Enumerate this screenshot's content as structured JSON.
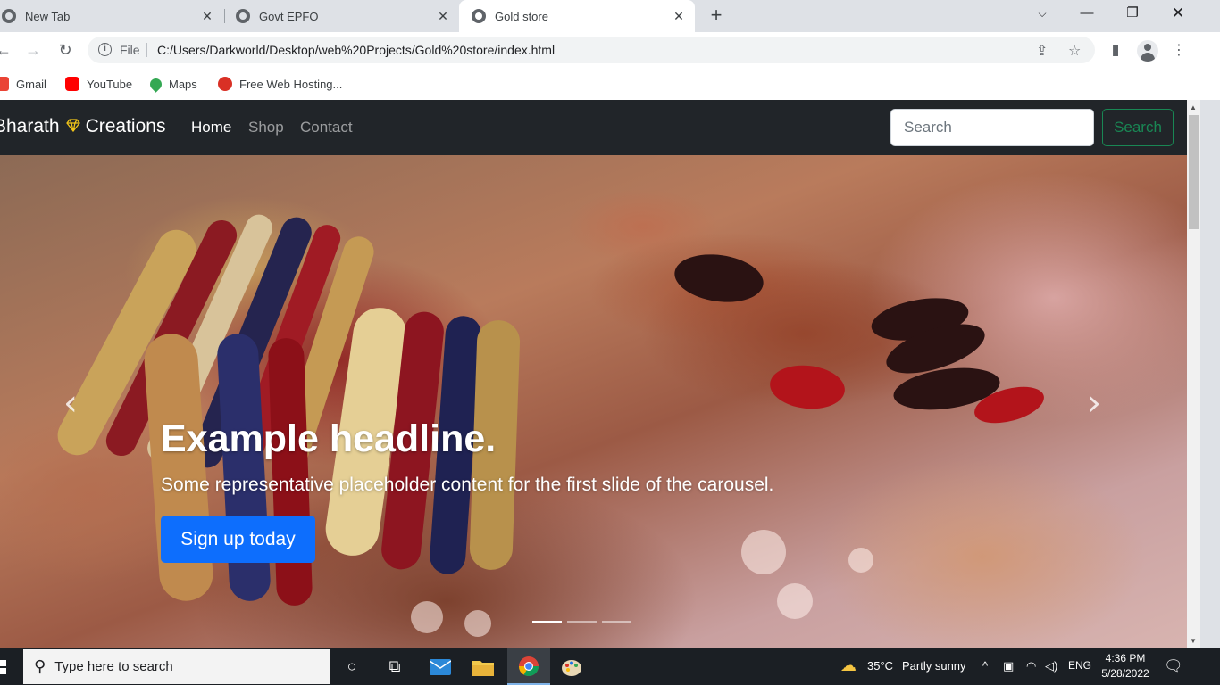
{
  "browser": {
    "tabs": [
      {
        "title": "New Tab",
        "active": false,
        "icon": "chrome-icon"
      },
      {
        "title": "Govt EPFO",
        "active": false,
        "icon": "globe-icon"
      },
      {
        "title": "Gold store",
        "active": true,
        "icon": "globe-icon"
      }
    ],
    "new_tab_label": "+",
    "omnibox": {
      "scheme_label": "File",
      "url": "C:/Users/Darkworld/Desktop/web%20Projects/Gold%20store/index.html"
    },
    "bookmarks": [
      {
        "label": "Gmail",
        "icon": "gmail-icon",
        "color": "#ea4335"
      },
      {
        "label": "YouTube",
        "icon": "youtube-icon",
        "color": "#ff0000"
      },
      {
        "label": "Maps",
        "icon": "maps-icon",
        "color": "#34a853"
      },
      {
        "label": "Free Web Hosting...",
        "icon": "hosting-icon",
        "color": "#d93025"
      }
    ]
  },
  "site": {
    "brand": {
      "left": "Bharath",
      "right": "Creations",
      "icon": "gem-icon",
      "icon_color": "#f0c419"
    },
    "nav": [
      {
        "label": "Home",
        "active": true
      },
      {
        "label": "Shop",
        "active": false
      },
      {
        "label": "Contact",
        "active": false
      }
    ],
    "search": {
      "placeholder": "Search",
      "button": "Search"
    },
    "carousel": {
      "headline": "Example headline.",
      "text": "Some representative placeholder content for the first slide of the carousel.",
      "cta": "Sign up today",
      "slide_count": 3,
      "active_slide": 1,
      "prev_icon": "chevron-left-icon",
      "next_icon": "chevron-right-icon"
    }
  },
  "taskbar": {
    "search_placeholder": "Type here to search",
    "weather": {
      "temp": "35°C",
      "condition": "Partly sunny"
    },
    "language": "ENG",
    "time": "4:36 PM",
    "date": "5/28/2022"
  },
  "colors": {
    "navbar_bg": "#212529",
    "primary": "#0d6efd",
    "success": "#198754"
  }
}
